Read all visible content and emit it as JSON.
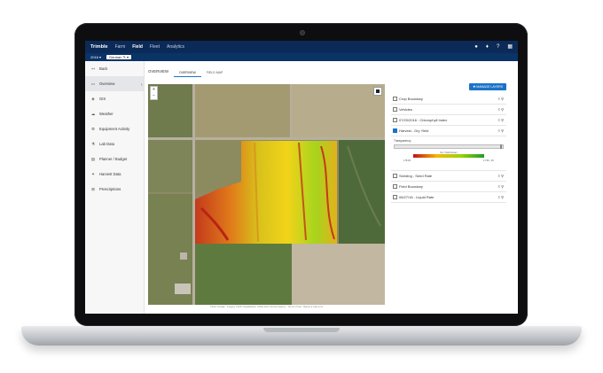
{
  "header": {
    "brand": "Trimble",
    "nav": [
      "Farm",
      "Field",
      "Fleet",
      "Analytics"
    ],
    "active_nav": "Field",
    "subbar": {
      "year": "2016 ▾",
      "farm": "German ✎ ▾"
    },
    "icons": [
      "user-icon",
      "bell-icon",
      "help-icon",
      "grid-icon"
    ]
  },
  "sidebar": {
    "items": [
      {
        "icon": "back-icon",
        "label": "Back"
      },
      {
        "icon": "overview-icon",
        "label": "Overview"
      },
      {
        "icon": "gis-icon",
        "label": "GIS"
      },
      {
        "icon": "weather-icon",
        "label": "Weather"
      },
      {
        "icon": "equipment-icon",
        "label": "Equipment Activity"
      },
      {
        "icon": "lab-icon",
        "label": "Lab Data"
      },
      {
        "icon": "planner-icon",
        "label": "Planner / Budget"
      },
      {
        "icon": "harvest-icon",
        "label": "Harvest Data"
      },
      {
        "icon": "prescription-icon",
        "label": "Prescriptions"
      }
    ]
  },
  "main": {
    "title": "OVERVIEW",
    "tabs": [
      "OVERVIEW",
      "FIELD MAP"
    ],
    "attribution": "©2017 Google · Imagery ©2017 DigitalGlobe, USDA Farm Service Agency · Terms of Use · Report a map error"
  },
  "panel": {
    "manage_button": "✚ MANAGE LAYERS",
    "layers": [
      {
        "name": "Crop Boundary",
        "checked": false
      },
      {
        "name": "Vehicles",
        "checked": false
      },
      {
        "name": "07/20/2016 : Chlorophyll Index",
        "checked": false
      },
      {
        "name": "Harvest - Dry Yield",
        "checked": true
      }
    ],
    "expanded": {
      "transparency_label": "Transparency",
      "legend_title": "Dry Yield (bu/ac)",
      "min_label": "178.45",
      "max_label": "17.56 - 00"
    },
    "layers_after": [
      {
        "name": "Seeding - Seed Rate",
        "checked": false
      },
      {
        "name": "Field Boundary",
        "checked": false
      },
      {
        "name": "06/27/16 - Liquid Rate",
        "checked": false
      }
    ],
    "action_icons": [
      "list-icon",
      "search-icon"
    ]
  }
}
